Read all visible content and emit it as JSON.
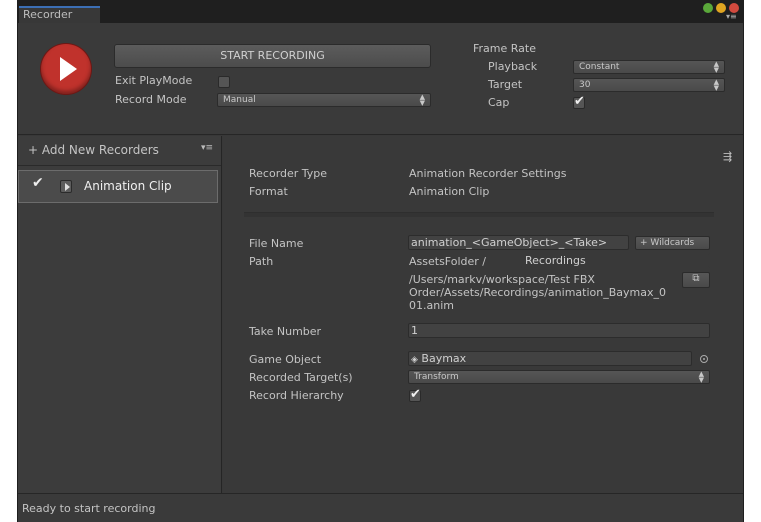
{
  "window": {
    "tab_title": "Recorder"
  },
  "header": {
    "start_button": "START RECORDING",
    "exit_playmode_label": "Exit PlayMode",
    "exit_playmode_checked": false,
    "record_mode_label": "Record Mode",
    "record_mode_value": "Manual",
    "frame_rate_title": "Frame Rate",
    "playback_label": "Playback",
    "playback_value": "Constant",
    "target_label": "Target",
    "target_value": "30",
    "cap_label": "Cap",
    "cap_checked": true
  },
  "sidebar": {
    "add_new_label": "+ Add New Recorders",
    "items": [
      {
        "label": "Animation Clip",
        "enabled": true
      }
    ]
  },
  "settings": {
    "recorder_type_label": "Recorder Type",
    "recorder_type_value": "Animation Recorder Settings",
    "format_label": "Format",
    "format_value": "Animation Clip",
    "file_name_label": "File Name",
    "file_name_value": "animation_<GameObject>_<Take>",
    "wildcards_button": "+ Wildcards",
    "path_label": "Path",
    "path_root": "AssetsFolder /",
    "path_folder": "Recordings",
    "path_full_line1": "/Users/markv/workspace/Test FBX",
    "path_full_line2": "Order/Assets/Recordings/animation_Baymax_0",
    "path_full_line3": "01.anim",
    "take_number_label": "Take Number",
    "take_number_value": "1",
    "game_object_label": "Game Object",
    "game_object_value": "Baymax",
    "recorded_targets_label": "Recorded Target(s)",
    "recorded_targets_value": "Transform",
    "record_hierarchy_label": "Record Hierarchy",
    "record_hierarchy_checked": true
  },
  "status": {
    "text": "Ready to start recording"
  }
}
